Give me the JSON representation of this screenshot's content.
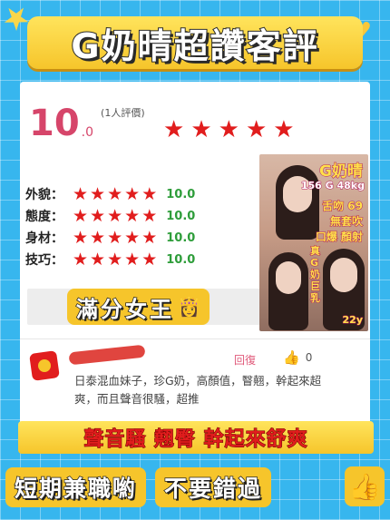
{
  "banner": {
    "title": "G奶晴超讚客評"
  },
  "review": {
    "score": "10",
    "score_decimal": ".0",
    "review_count": "(1人評價)",
    "overall_stars": 5,
    "criteria": [
      {
        "label": "外貌：",
        "stars": 5,
        "value": "10.0"
      },
      {
        "label": "態度：",
        "stars": 5,
        "value": "10.0"
      },
      {
        "label": "身材：",
        "stars": 5,
        "value": "10.0"
      },
      {
        "label": "技巧：",
        "stars": 5,
        "value": "10.0"
      }
    ],
    "badge": "滿分女王",
    "reply_label": "回復",
    "like_count": "0",
    "comment": "日泰混血妹子，珍G奶，高顏值，瞖翹，幹起來超爽，而且聲音很騷，超推"
  },
  "photo": {
    "name": "G奶晴",
    "spec": "156 G 48kg",
    "line1": "舌吻 69",
    "line2": "無套吹",
    "line3": "口爆 顏射",
    "vertical": "真G奶巨乳",
    "age": "22y"
  },
  "slogans": {
    "line1": "聲音騷 翹臀 幹起來舒爽",
    "pill1": "短期兼職喲",
    "pill2": "不要錯過"
  },
  "colors": {
    "star": "#e11d1d",
    "score": "#d6456a",
    "value": "#2e9d3a",
    "background": "#37b6ee",
    "accent": "#f6c52b"
  }
}
